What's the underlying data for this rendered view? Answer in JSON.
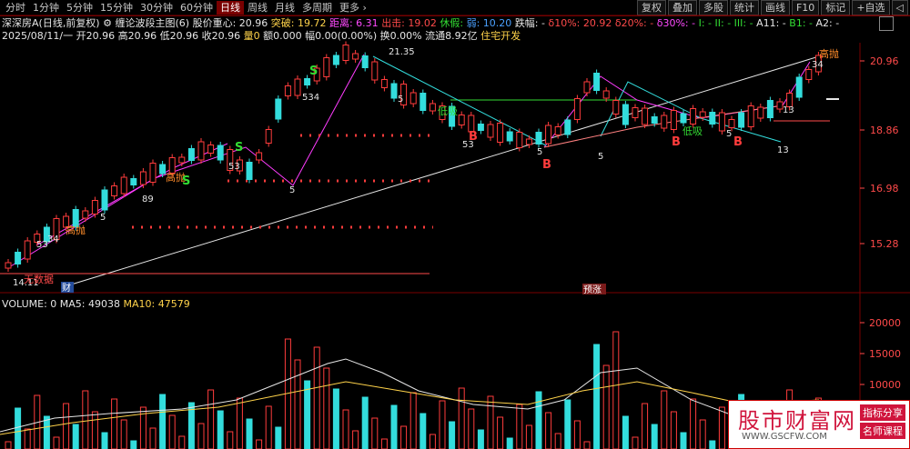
{
  "toolbar": {
    "periods": [
      "分时",
      "1分钟",
      "5分钟",
      "15分钟",
      "30分钟",
      "60分钟",
      "日线",
      "周线",
      "月线",
      "多周期",
      "更多 ›"
    ],
    "active_period": "日线",
    "right_buttons": [
      "复权",
      "叠加",
      "多股",
      "统计",
      "画线",
      "F10",
      "标记",
      "+自选",
      "◁"
    ]
  },
  "info_line1": {
    "stock": "深深房A(日线,前复权)",
    "indicator": "缠论波段主图(6)",
    "gravity_label": "股价重心: 20.96",
    "breakout_label": "突破: 19.72",
    "distance_label": "距离: 6.31",
    "exit_label": "出击: 19.02",
    "rest_label": "休假:",
    "weak_label": "弱: 10.20",
    "fall_label": "跌幅: -",
    "pct10_label": "δ10%: 20.92",
    "pct20_label": "δ20%: -",
    "pct30_label": "δ30%: -",
    "i_label": "I: -",
    "ii_label": "II: -",
    "iii_label": "III: -",
    "a11_label": "A11: -",
    "b1_label": "B1: -",
    "a2_label": "A2: -"
  },
  "info_line2": {
    "date": "2025/08/11/一",
    "open": "开20.96",
    "high": "高20.96",
    "low": "低20.96",
    "close": "收20.96",
    "volume": "量0",
    "amount": "额0.000",
    "amplitude": "幅0.00(0.00%)",
    "turnover": "换0.00%",
    "float": "流通8.92亿",
    "sector": "住宅开发"
  },
  "price_axis": [
    "20.96",
    "18.86",
    "16.98",
    "15.28"
  ],
  "volume_axis": [
    "20000",
    "15000",
    "10000"
  ],
  "volume_info": {
    "volume": "VOLUME: 0",
    "ma5": "MA5: 49038",
    "ma10": "MA10: 47579"
  },
  "chart_labels": {
    "high_sell_1": "高抛",
    "high_sell_2": "高抛",
    "high_sell_3": "高抛",
    "low_buy": "低吸",
    "low_buy_2": "低吸",
    "price_high": "21.35",
    "price_low": "14.11",
    "no_data": "无数据",
    "finance_tag": "财",
    "forecast_tag": "预涨",
    "buy_b": "B",
    "sell_s": "S",
    "num_5": "5",
    "num_53": "53",
    "num_13": "13",
    "num_34": "34",
    "num_534": "534",
    "num_89": "89"
  },
  "colors": {
    "up": "#ff3c3c",
    "down": "#33dddd",
    "accent_yellow": "#ffd34a",
    "magenta": "#ff3cff",
    "cyan_line": "#33dddd",
    "green": "#33dd33",
    "grid_red": "#7a0000"
  },
  "logo": {
    "title": "股市财富网",
    "tag1": "指标分享",
    "tag2": "名师课程",
    "url": "WWW.GSCFW.COM"
  }
}
